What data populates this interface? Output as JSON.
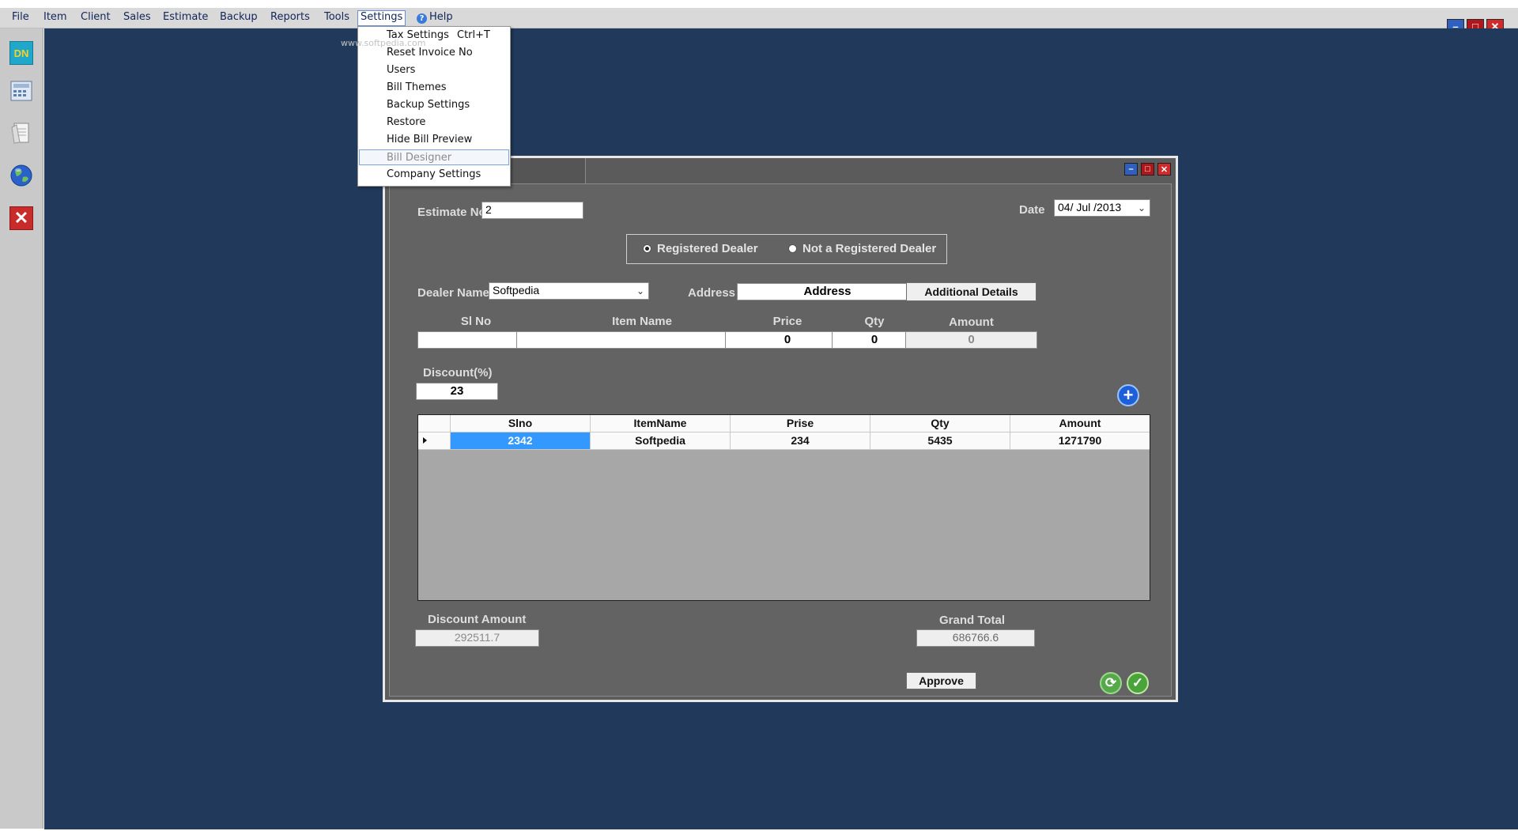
{
  "menubar": {
    "items": [
      "File",
      "Item",
      "Client",
      "Sales",
      "Estimate",
      "Backup",
      "Reports",
      "Tools",
      "Settings",
      "Help"
    ]
  },
  "settings_menu": {
    "items": [
      {
        "label": "Tax Settings",
        "shortcut": "Ctrl+T"
      },
      {
        "label": "Reset Invoice No"
      },
      {
        "label": "Users"
      },
      {
        "label": "Bill Themes"
      },
      {
        "label": "Backup Settings"
      },
      {
        "label": "Restore"
      },
      {
        "label": "Hide Bill Preview"
      },
      {
        "label": "Bill Designer"
      },
      {
        "label": "Company Settings"
      }
    ],
    "watermark": "www.softpedia.com"
  },
  "sidebar": {
    "icons": [
      "dn-logo-icon",
      "calculator-icon",
      "notes-icon",
      "globe-icon",
      "exit-icon"
    ],
    "dn_text": "DN"
  },
  "colors": {
    "workspace": "#213a5c",
    "panel": "#636363",
    "grid_selected": "#3399ff",
    "sidebar": "#c9c9c9",
    "menubar": "#d9d9d9"
  },
  "form": {
    "estimate_no_label": "Estimate No",
    "estimate_no_value": "2",
    "date_label": "Date",
    "date_value": "04/ Jul /2013",
    "registered_label": "Registered Dealer",
    "not_registered_label": "Not a Registered Dealer",
    "registered_selected": true,
    "dealer_name_label": "Dealer Name",
    "dealer_name_value": "Softpedia",
    "address_label": "Address",
    "address_value": "Address",
    "additional_details_label": "Additional Details",
    "slno_label": "Sl No",
    "item_name_label": "Item Name",
    "price_label": "Price",
    "qty_label": "Qty",
    "amount_label": "Amount",
    "slno_value": "",
    "item_name_value": "",
    "price_value": "0",
    "qty_value": "0",
    "amount_value": "0",
    "discount_label": "Discount(%)",
    "discount_value": "23",
    "discount_amount_label": "Discount Amount",
    "discount_amount_value": "292511.7",
    "grand_total_label": "Grand Total",
    "grand_total_value": "686766.6",
    "approve_label": "Approve"
  },
  "grid": {
    "columns": [
      "Slno",
      "ItemName",
      "Prise",
      "Qty",
      "Amount"
    ],
    "rows": [
      [
        "2342",
        "Softpedia",
        "234",
        "5435",
        "1271790"
      ]
    ]
  }
}
